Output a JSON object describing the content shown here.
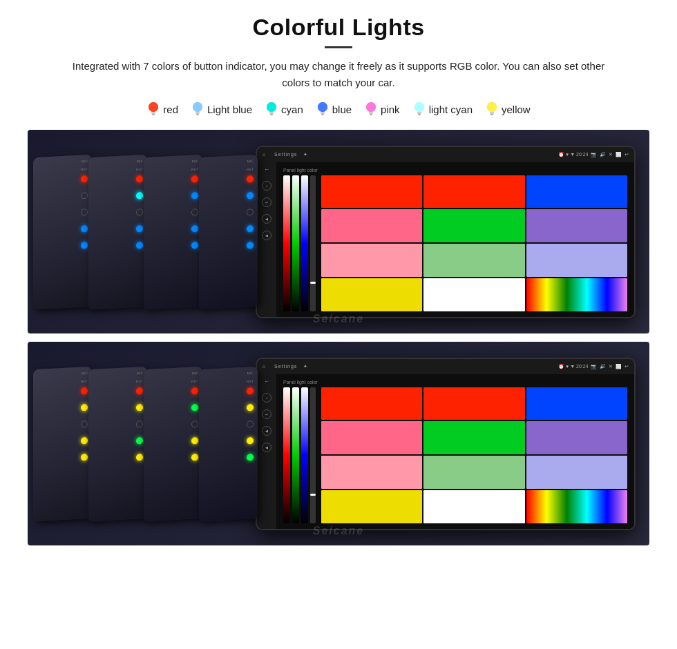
{
  "header": {
    "title": "Colorful Lights",
    "description": "Integrated with 7 colors of button indicator, you may change it freely as it supports RGB color. You can also set other colors to match your car."
  },
  "colors": [
    {
      "name": "red",
      "color": "#ff2200",
      "glow": "#ff4422"
    },
    {
      "name": "Light blue",
      "color": "#66aaff",
      "glow": "#88ccff"
    },
    {
      "name": "cyan",
      "color": "#00dddd",
      "glow": "#00ffff"
    },
    {
      "name": "blue",
      "color": "#2255ff",
      "glow": "#4477ff"
    },
    {
      "name": "pink",
      "color": "#ff55cc",
      "glow": "#ff77dd"
    },
    {
      "name": "light cyan",
      "color": "#88eeff",
      "glow": "#aaffff"
    },
    {
      "name": "yellow",
      "color": "#ffdd00",
      "glow": "#ffee44"
    }
  ],
  "units": [
    {
      "id": "top-unit",
      "screen": {
        "title": "Settings",
        "time": "20:24",
        "panel_label": "Panel light color"
      },
      "light_color": "blue"
    },
    {
      "id": "bottom-unit",
      "screen": {
        "title": "Settings",
        "time": "20:24",
        "panel_label": "Panel light color"
      },
      "light_color": "yellow"
    }
  ],
  "watermark": "Seicane"
}
